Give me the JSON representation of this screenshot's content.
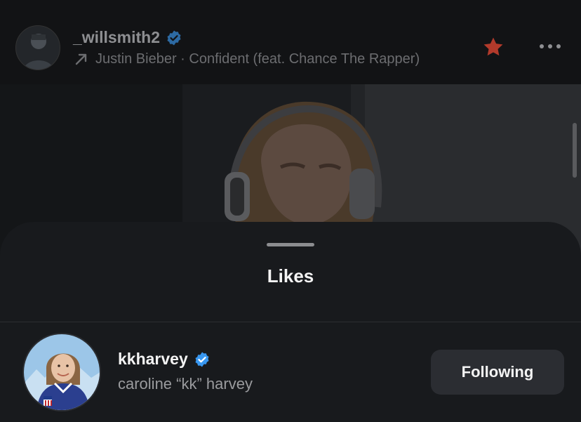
{
  "post": {
    "username": "_willsmith2",
    "song": "Justin Bieber · Confident (feat. Chance The Rapper)",
    "icons": {
      "verified": "verified-badge-icon",
      "repost": "arrow-up-right-icon",
      "favorite": "star-icon",
      "more": "more-icon"
    }
  },
  "sheet": {
    "title": "Likes"
  },
  "likes": [
    {
      "username": "kkharvey",
      "full_name": "caroline “kk” harvey",
      "verified": true,
      "button_label": "Following"
    }
  ],
  "colors": {
    "verified_blue": "#3897f0",
    "star": "#c0392b",
    "sheet_bg": "#181a1d",
    "button_bg": "#2b2d32"
  }
}
